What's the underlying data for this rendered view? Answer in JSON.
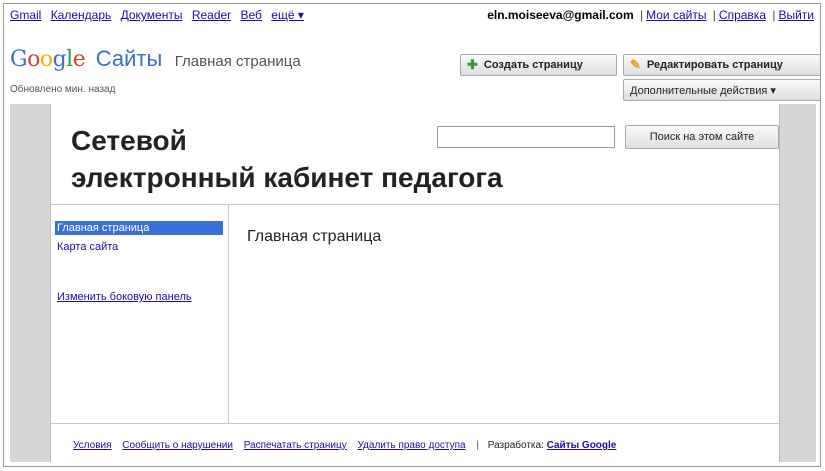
{
  "topnav": {
    "items": [
      "Gmail",
      "Календарь",
      "Документы",
      "Reader",
      "Веб",
      "ещё ▾"
    ]
  },
  "account": {
    "email": "eln.moiseeva@gmail.com",
    "links": [
      "Мои сайты",
      "Справка",
      "Выйти"
    ]
  },
  "brand": {
    "logo_letters": [
      "G",
      "o",
      "o",
      "g",
      "l",
      "e"
    ],
    "logo_colors": [
      "#3c6ec8",
      "#d6402e",
      "#f0b400",
      "#3c6ec8",
      "#2d9b3f",
      "#d6402e"
    ],
    "sites": "Сайты",
    "page_title": "Главная страница",
    "updated": "Обновлено мин. назад"
  },
  "toolbar": {
    "create_label": "Создать страницу",
    "edit_label": "Редактировать страницу",
    "more_label": "Дополнительные действия ▾"
  },
  "site": {
    "title_line1": "Сетевой",
    "title_line2": "электронный кабинет педагога",
    "search_value": "",
    "search_button": "Поиск на этом сайте"
  },
  "sidebar": {
    "active_item": "Главная страница",
    "items": [
      "Карта сайта"
    ],
    "edit_link": "Изменить боковую панель"
  },
  "main": {
    "content_title": "Главная страница"
  },
  "footer": {
    "links": [
      "Условия",
      "Сообщить о нарушении",
      "Распечатать страницу",
      "Удалить право доступа"
    ],
    "dev_label": "Разработка:",
    "dev_link": "Сайты Google"
  },
  "colors": {
    "accent": "#3b6fd8",
    "link": "#1a0dab",
    "stage_bg": "#d6d6d6"
  }
}
